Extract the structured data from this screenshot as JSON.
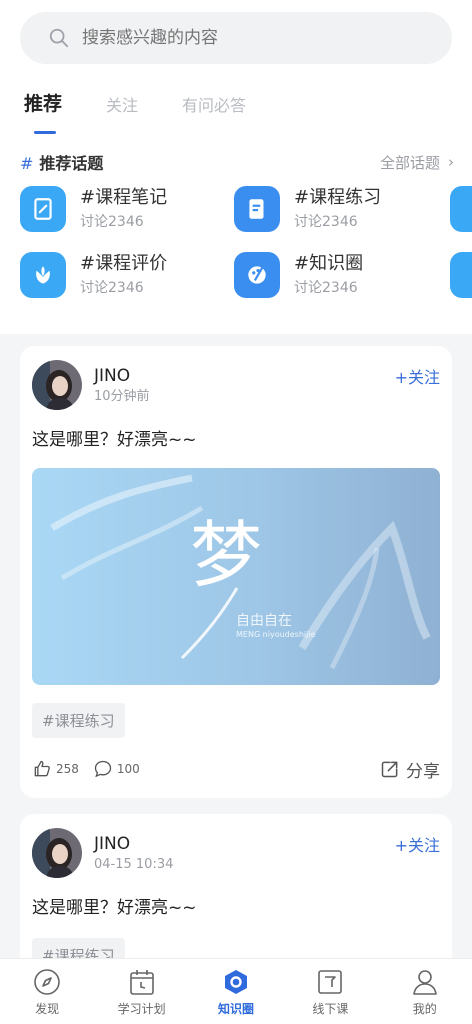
{
  "search": {
    "placeholder": "搜索感兴趣的内容"
  },
  "tabs": [
    {
      "label": "推荐",
      "active": true
    },
    {
      "label": "关注",
      "active": false
    },
    {
      "label": "有问必答",
      "active": false
    }
  ],
  "topics_section": {
    "hash": "#",
    "title": "推荐话题",
    "all_label": "全部话题",
    "all_chevron": "›"
  },
  "topics": [
    {
      "name": "#课程笔记",
      "sub": "讨论2346",
      "icon": "notebook-icon",
      "color": "#3aa8f5"
    },
    {
      "name": "#课程练习",
      "sub": "讨论2346",
      "icon": "document-edit-icon",
      "color": "#3a8ef0"
    },
    {
      "name": "#课程评价",
      "sub": "讨论2346",
      "icon": "flower-icon",
      "color": "#3aa8f5"
    },
    {
      "name": "#知识圈",
      "sub": "讨论2346",
      "icon": "palette-icon",
      "color": "#3a8ef0"
    }
  ],
  "posts": [
    {
      "user": "JINO",
      "time": "10分钟前",
      "follow": "+关注",
      "text": "这是哪里？好漂亮~~",
      "image_title": "梦",
      "image_caption": "自由自在",
      "image_sub": "MENG  niyoudeshijie",
      "tag": "#课程练习",
      "likes": "258",
      "comments": "100",
      "share": "分享"
    },
    {
      "user": "JINO",
      "time": "04-15 10:34",
      "follow": "+关注",
      "text": "这是哪里？好漂亮~~",
      "tag": "#课程练习"
    }
  ],
  "nav": [
    {
      "label": "发现",
      "icon": "compass-icon",
      "active": false
    },
    {
      "label": "学习计划",
      "icon": "calendar-icon",
      "active": false
    },
    {
      "label": "知识圈",
      "icon": "knowledge-circle-icon",
      "active": true
    },
    {
      "label": "线下课",
      "icon": "offline-class-icon",
      "active": false
    },
    {
      "label": "我的",
      "icon": "profile-icon",
      "active": false
    }
  ],
  "colors": {
    "accent": "#2f6bdc",
    "follow": "#3a6fd8"
  }
}
